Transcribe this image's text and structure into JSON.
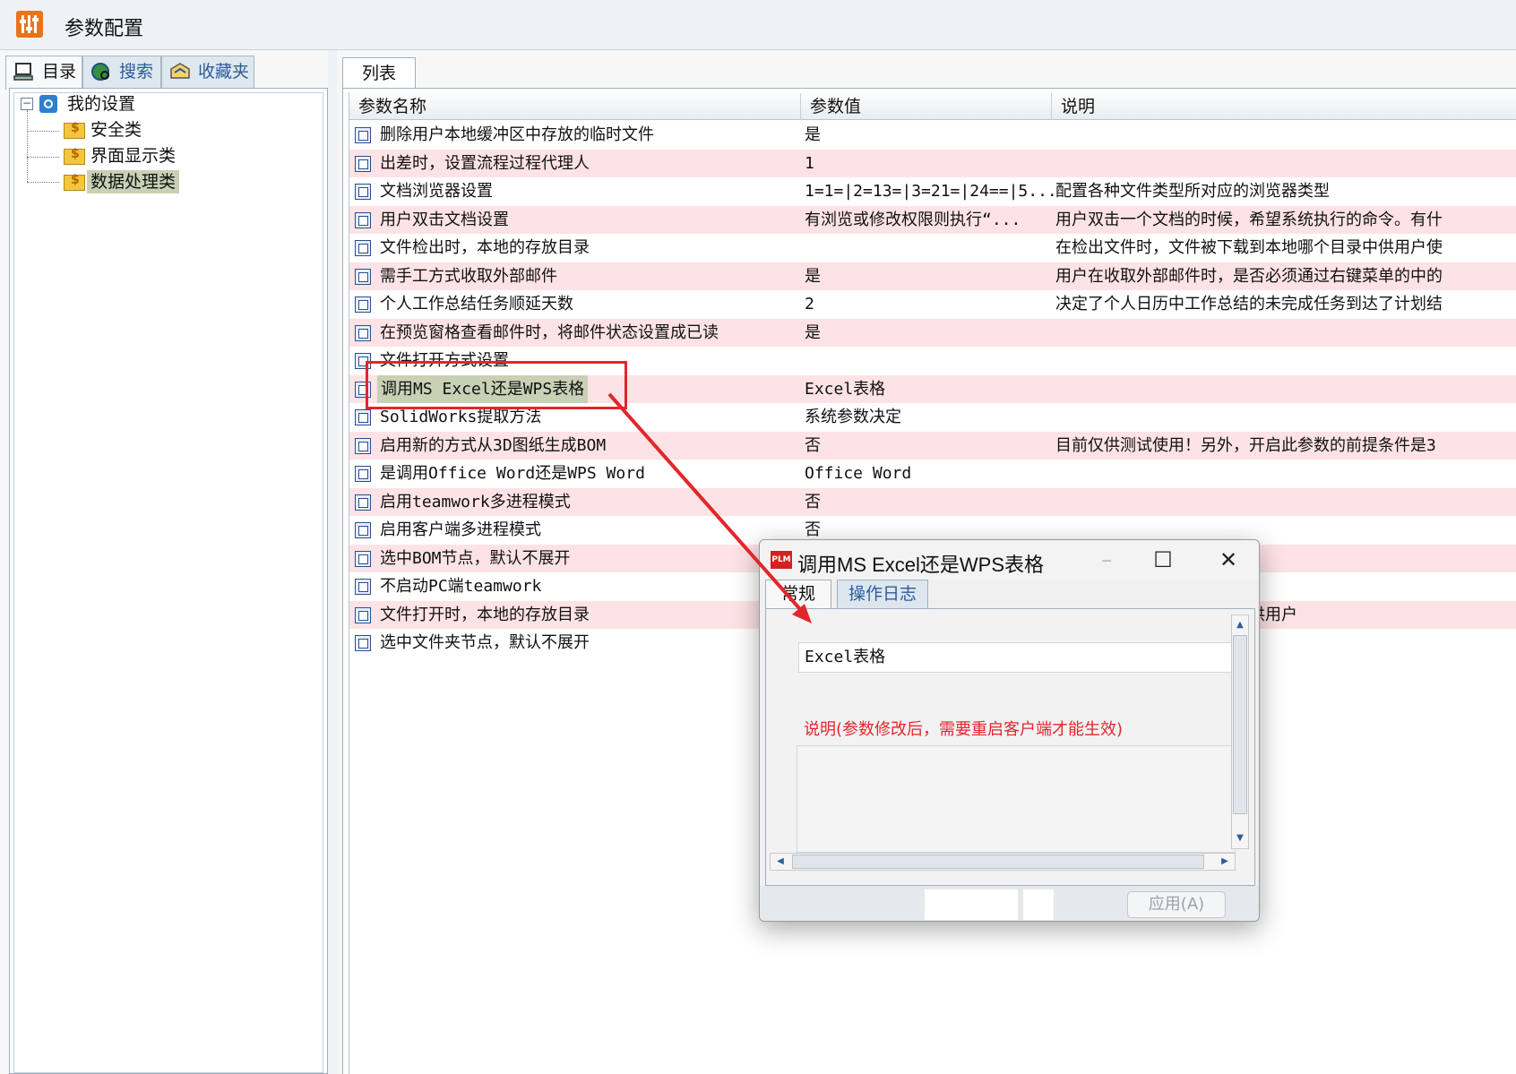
{
  "window": {
    "title": "参数配置"
  },
  "left_tabs": [
    {
      "label": "目录",
      "icon": "computer-icon"
    },
    {
      "label": "搜索",
      "icon": "search-globe-icon"
    },
    {
      "label": "收藏夹",
      "icon": "favorites-icon"
    }
  ],
  "tree": {
    "root": "我的设置",
    "children": [
      "安全类",
      "界面显示类",
      "数据处理类"
    ],
    "selected": "数据处理类"
  },
  "right_tab": "列表",
  "grid": {
    "columns": [
      "参数名称",
      "参数值",
      "说明"
    ],
    "rows": [
      {
        "name": "删除用户本地缓冲区中存放的临时文件",
        "value": "是",
        "desc": ""
      },
      {
        "name": "出差时，设置流程过程代理人",
        "value": "1",
        "desc": ""
      },
      {
        "name": "文档浏览器设置",
        "value": "1=1=|2=13=|3=21=|24==|5...",
        "desc": "配置各种文件类型所对应的浏览器类型"
      },
      {
        "name": "用户双击文档设置",
        "value": "有浏览或修改权限则执行“...",
        "desc": "用户双击一个文档的时候，希望系统执行的命令。有什"
      },
      {
        "name": "文件检出时，本地的存放目录",
        "value": "",
        "desc": "在检出文件时，文件被下载到本地哪个目录中供用户使"
      },
      {
        "name": "需手工方式收取外部邮件",
        "value": "是",
        "desc": "用户在收取外部邮件时，是否必须通过右键菜单的中的"
      },
      {
        "name": "个人工作总结任务顺延天数",
        "value": "2",
        "desc": "决定了个人日历中工作总结的未完成任务到达了计划结"
      },
      {
        "name": "在预览窗格查看邮件时，将邮件状态设置成已读",
        "value": "是",
        "desc": ""
      },
      {
        "name": "文件打开方式设置",
        "value": "",
        "desc": ""
      },
      {
        "name": "调用MS Excel还是WPS表格",
        "value": "Excel表格",
        "desc": ""
      },
      {
        "name": "SolidWorks提取方法",
        "value": "系统参数决定",
        "desc": ""
      },
      {
        "name": "启用新的方式从3D图纸生成BOM",
        "value": "否",
        "desc": "目前仅供测试使用！另外，开启此参数的前提条件是3"
      },
      {
        "name": "是调用Office Word还是WPS Word",
        "value": "Office Word",
        "desc": ""
      },
      {
        "name": "启用teamwork多进程模式",
        "value": "否",
        "desc": ""
      },
      {
        "name": "启用客户端多进程模式",
        "value": "否",
        "desc": ""
      },
      {
        "name": "选中BOM节点，默认不展开",
        "value": "",
        "desc": ""
      },
      {
        "name": "不启动PC端teamwork",
        "value": "",
        "desc": ""
      },
      {
        "name": "文件打开时，本地的存放目录",
        "value": "",
        "desc": "件被下载到本地哪个目录中供用户"
      },
      {
        "name": "选中文件夹节点，默认不展开",
        "value": "",
        "desc": ""
      }
    ],
    "selected_row": "调用MS Excel还是WPS表格"
  },
  "dialog": {
    "app_badge": "PLM",
    "title": "调用MS Excel还是WPS表格",
    "tabs": [
      "常规",
      "操作日志"
    ],
    "value": "Excel表格",
    "note": "说明(参数修改后，需要重启客户端才能生效)",
    "apply_label": "应用(A)"
  },
  "colors": {
    "annotation": "#e2262c",
    "pink_row": "#fde3e5",
    "selection": "#c8d0b5",
    "app_icon": "#e8731c"
  }
}
